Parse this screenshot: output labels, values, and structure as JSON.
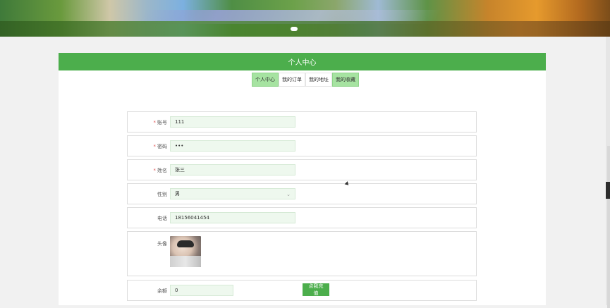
{
  "header": {
    "title": "个人中心"
  },
  "tabs": [
    {
      "label": "个人中心",
      "active": true
    },
    {
      "label": "我的订单",
      "active": false
    },
    {
      "label": "我的地址",
      "active": false
    },
    {
      "label": "我的收藏",
      "active": false
    }
  ],
  "form": {
    "account": {
      "label": "账号",
      "value": "111",
      "required": true
    },
    "password": {
      "label": "密码",
      "value": "•••",
      "required": true
    },
    "name": {
      "label": "姓名",
      "value": "张三",
      "required": true
    },
    "gender": {
      "label": "性别",
      "value": "男",
      "required": false
    },
    "phone": {
      "label": "电话",
      "value": "18156041454",
      "required": false
    },
    "avatar": {
      "label": "头像"
    },
    "balance": {
      "label": "余额",
      "value": "0",
      "button": "点我充值"
    }
  },
  "colors": {
    "accent": "#4cae4c",
    "tab_active": "#a6e3a1",
    "input_bg": "#eef8ee"
  }
}
